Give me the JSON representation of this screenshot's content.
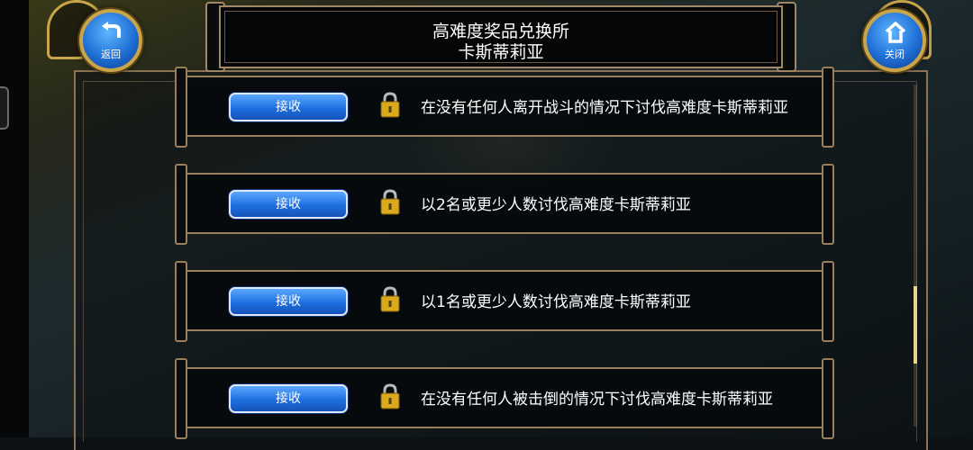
{
  "header": {
    "title_line1": "高难度奖品兑换所",
    "title_line2": "卡斯蒂莉亚"
  },
  "nav": {
    "back_label": "返回",
    "close_label": "关闭"
  },
  "rewards": [
    {
      "button_label": "接收",
      "locked": true,
      "description": "在没有任何人离开战斗的情况下讨伐高难度卡斯蒂莉亚"
    },
    {
      "button_label": "接收",
      "locked": true,
      "description": "以2名或更少人数讨伐高难度卡斯蒂莉亚"
    },
    {
      "button_label": "接收",
      "locked": true,
      "description": "以1名或更少人数讨伐高难度卡斯蒂莉亚"
    },
    {
      "button_label": "接收",
      "locked": true,
      "description": "在没有任何人被击倒的情况下讨伐高难度卡斯蒂莉亚"
    }
  ],
  "icons": [
    "back-icon",
    "home-icon",
    "lock-icon"
  ],
  "colors": {
    "button_blue": "#1f6ee0",
    "frame_bronze": "#9a7f5e",
    "lock_gold": "#d9a920"
  }
}
